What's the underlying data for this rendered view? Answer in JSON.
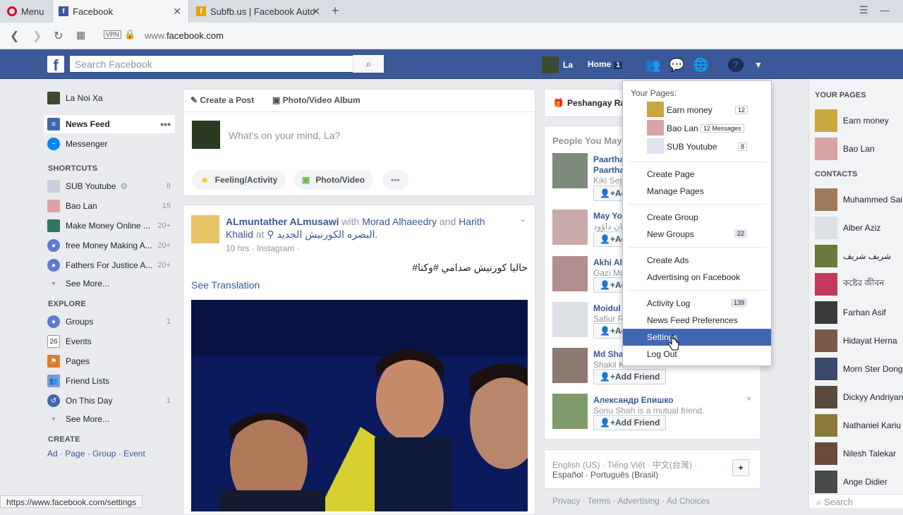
{
  "browser": {
    "menu_label": "Menu",
    "tabs": [
      {
        "label": "Facebook"
      },
      {
        "label": "Subfb.us | Facebook Auto"
      }
    ],
    "url_prefix": "www.",
    "url_domain": "facebook.com",
    "vpn": "VPN",
    "status_url": "https://www.facebook.com/settings"
  },
  "header": {
    "search_placeholder": "Search Facebook",
    "user": "La",
    "home": "Home",
    "home_count": "1"
  },
  "left": {
    "profile": "La Noi Xa",
    "top": [
      {
        "label": "News Feed",
        "count": ""
      },
      {
        "label": "Messenger",
        "count": ""
      }
    ],
    "shortcuts_title": "SHORTCUTS",
    "shortcuts": [
      {
        "label": "SUB Youtube",
        "count": "8"
      },
      {
        "label": "Bao Lan",
        "count": "15"
      },
      {
        "label": "Make Money Online ...",
        "count": "20+"
      },
      {
        "label": "free Money Making A...",
        "count": "20+"
      },
      {
        "label": "Fathers For Justice A...",
        "count": "20+"
      }
    ],
    "see_more": "See More...",
    "explore_title": "EXPLORE",
    "explore": [
      {
        "label": "Groups",
        "count": "1"
      },
      {
        "label": "Events",
        "count": ""
      },
      {
        "label": "Pages",
        "count": ""
      },
      {
        "label": "Friend Lists",
        "count": ""
      },
      {
        "label": "On This Day",
        "count": "1"
      }
    ],
    "events_num": "26",
    "create_title": "CREATE",
    "create_links": [
      "Ad",
      "Page",
      "Group",
      "Event"
    ]
  },
  "composer": {
    "create_post": "Create a Post",
    "photo_album": "Photo/Video Album",
    "placeholder": "What's on your mind, La?",
    "feeling": "Feeling/Activity",
    "photo_video": "Photo/Video",
    "more": "•••"
  },
  "post": {
    "author": "ALmuntather ALmusawi",
    "with": "with",
    "tag1": "Morad Alhaeedry",
    "and": "and",
    "tag2": "Harith Khalid",
    "at": "at",
    "place": "البصره الكورنيش الجديد.",
    "meta": "10 hrs · Instagram ·",
    "text": "#حاليا كورنيش صدامي #وكتا",
    "see_translation": "See Translation"
  },
  "right": {
    "page_suggest": "Peshangay Ra",
    "pym_title": "People You May",
    "people": [
      {
        "name": "Paartha",
        "name2": "Paartha",
        "sub": "Kiki Sep"
      },
      {
        "name": "May Yo",
        "name2": "",
        "sub": "يمان داؤود"
      },
      {
        "name": "Akhi Al",
        "name2": "",
        "sub": "Gazi Mo"
      },
      {
        "name": "Moidul",
        "name2": "",
        "sub": "Safiur R"
      },
      {
        "name": "Md Sha",
        "name2": "",
        "sub": "Shakil K"
      },
      {
        "name": "Александр Епишко",
        "name2": "",
        "sub": "Sonu Shah is a mutual friend."
      }
    ],
    "add_friend": "Add Friend",
    "add_short": "Ad",
    "footer_langs": "English (US) · Tiếng Việt · 中文(台灣) ·",
    "footer_langs2": "Español · Português (Brasil)",
    "footer_links": "Privacy · Terms · Advertising · Ad Choices",
    "close": "×"
  },
  "dropdown": {
    "your_pages": "Your Pages:",
    "pages": [
      {
        "label": "Earn money",
        "count": "12"
      },
      {
        "label": "Bao Lan",
        "count": "12 Messages"
      },
      {
        "label": "SUB Youtube",
        "count": "8"
      }
    ],
    "items": [
      "Create Page",
      "Manage Pages",
      "Create Group",
      "New Groups",
      "Create Ads",
      "Advertising on Facebook",
      "Activity Log",
      "News Feed Preferences",
      "Settings",
      "Log Out"
    ],
    "new_groups_count": "22",
    "activity_count": "139"
  },
  "sidebar": {
    "your_pages": "YOUR PAGES",
    "pages": [
      "Earn money",
      "Bao Lan"
    ],
    "contacts_title": "CONTACTS",
    "contacts": [
      "Muhammed Sai",
      "Alber Aziz",
      "شريف شريف",
      "কষ্টের জীবন",
      "Farhan Asif",
      "Hidayat Herna",
      "Morn Ster Dong",
      "Dickyy Andriyan",
      "Nathaniel Kariu",
      "Nilesh Talekar",
      "Ange Didier"
    ],
    "search": "Search"
  },
  "colors": {
    "fb_blue": "#3b5998",
    "link": "#365899",
    "selected": "#4267b2"
  }
}
